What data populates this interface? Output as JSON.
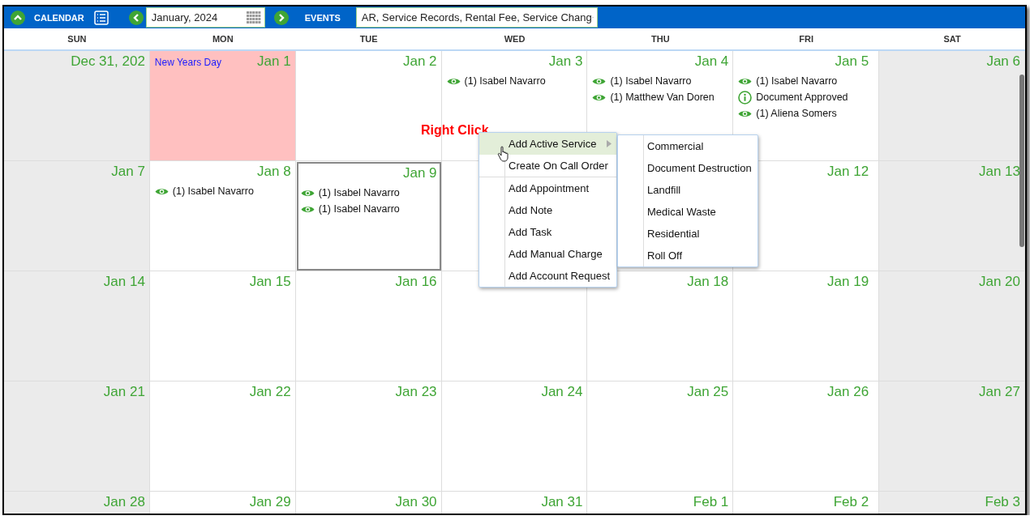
{
  "toolbar": {
    "title": "CALENDAR",
    "month": "January, 2024",
    "events_label": "EVENTS",
    "events_filter": "AR, Service Records, Rental Fee, Service Chang"
  },
  "weekdays": [
    "SUN",
    "MON",
    "TUE",
    "WED",
    "THU",
    "FRI",
    "SAT"
  ],
  "weeks": [
    [
      {
        "date": "Dec 31, 202",
        "kind": "weekend",
        "selected": false
      },
      {
        "date": "Jan 1",
        "kind": "holiday",
        "selected": false,
        "holiday": "New Years Day"
      },
      {
        "date": "Jan 2",
        "kind": "weekday",
        "selected": false
      },
      {
        "date": "Jan 3",
        "kind": "weekday",
        "selected": false,
        "events": [
          {
            "kind": "view",
            "text": "(1) Isabel Navarro"
          }
        ]
      },
      {
        "date": "Jan 4",
        "kind": "weekday",
        "selected": false,
        "events": [
          {
            "kind": "view",
            "text": "(1) Isabel Navarro"
          },
          {
            "kind": "view",
            "text": "(1) Matthew Van Doren"
          }
        ]
      },
      {
        "date": "Jan 5",
        "kind": "weekday",
        "selected": false,
        "events": [
          {
            "kind": "view",
            "text": "(1) Isabel Navarro"
          },
          {
            "kind": "info",
            "text": "Document Approved"
          },
          {
            "kind": "view",
            "text": "(1) Aliena Somers"
          }
        ]
      },
      {
        "date": "Jan 6",
        "kind": "weekend",
        "selected": false
      }
    ],
    [
      {
        "date": "Jan 7",
        "kind": "weekend",
        "selected": false
      },
      {
        "date": "Jan 8",
        "kind": "weekday",
        "selected": false,
        "events": [
          {
            "kind": "view",
            "text": "(1) Isabel Navarro"
          }
        ]
      },
      {
        "date": "Jan 9",
        "kind": "weekday",
        "selected": true,
        "events": [
          {
            "kind": "view",
            "text": "(1) Isabel Navarro"
          },
          {
            "kind": "view",
            "text": "(1) Isabel Navarro"
          }
        ]
      },
      {
        "kind": "weekday",
        "selected": false
      },
      {
        "kind": "weekday",
        "selected": false
      },
      {
        "date": "Jan 12",
        "kind": "weekday",
        "selected": false
      },
      {
        "date": "Jan 13",
        "kind": "weekend",
        "selected": false
      }
    ],
    [
      {
        "date": "Jan 14",
        "kind": "weekend",
        "selected": false
      },
      {
        "date": "Jan 15",
        "kind": "weekday",
        "selected": false
      },
      {
        "date": "Jan 16",
        "kind": "weekday",
        "selected": false
      },
      {
        "kind": "weekday",
        "selected": false
      },
      {
        "date": "Jan 18",
        "kind": "weekday",
        "selected": false
      },
      {
        "date": "Jan 19",
        "kind": "weekday",
        "selected": false
      },
      {
        "date": "Jan 20",
        "kind": "weekend",
        "selected": false
      }
    ],
    [
      {
        "date": "Jan 21",
        "kind": "weekend",
        "selected": false
      },
      {
        "date": "Jan 22",
        "kind": "weekday",
        "selected": false
      },
      {
        "date": "Jan 23",
        "kind": "weekday",
        "selected": false
      },
      {
        "date": "Jan 24",
        "kind": "weekday",
        "selected": false
      },
      {
        "date": "Jan 25",
        "kind": "weekday",
        "selected": false
      },
      {
        "date": "Jan 26",
        "kind": "weekday",
        "selected": false
      },
      {
        "date": "Jan 27",
        "kind": "weekend",
        "selected": false
      }
    ],
    [
      {
        "date": "Jan 28",
        "kind": "weekend",
        "selected": false
      },
      {
        "date": "Jan 29",
        "kind": "weekday",
        "selected": false
      },
      {
        "date": "Jan 30",
        "kind": "weekday",
        "selected": false
      },
      {
        "date": "Jan 31",
        "kind": "weekday",
        "selected": false
      },
      {
        "date": "Feb 1",
        "kind": "weekday",
        "selected": false
      },
      {
        "date": "Feb 2",
        "kind": "weekday",
        "selected": false
      },
      {
        "date": "Feb 3",
        "kind": "weekend",
        "selected": false
      }
    ]
  ],
  "annotation": "Right Click",
  "context_menu": {
    "groups": [
      [
        {
          "label": "Add Active Service",
          "highlighted": true,
          "has_submenu": true
        },
        {
          "label": "Create On Call Order",
          "highlighted": false,
          "has_submenu": false
        }
      ],
      [
        {
          "label": "Add Appointment",
          "highlighted": false,
          "has_submenu": false
        },
        {
          "label": "Add Note",
          "highlighted": false,
          "has_submenu": false
        },
        {
          "label": "Add Task",
          "highlighted": false,
          "has_submenu": false
        },
        {
          "label": "Add Manual Charge",
          "highlighted": false,
          "has_submenu": false
        },
        {
          "label": "Add Account Request",
          "highlighted": false,
          "has_submenu": false
        }
      ]
    ],
    "submenu": [
      "Commercial",
      "Document Destruction",
      "Landfill",
      "Medical Waste",
      "Residential",
      "Roll Off"
    ]
  }
}
